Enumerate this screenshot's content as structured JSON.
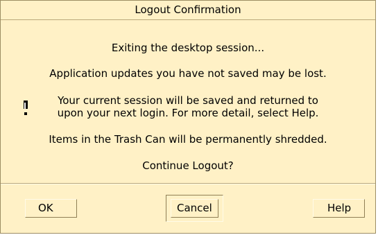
{
  "dialog": {
    "title": "Logout Confirmation",
    "messages": [
      "Exiting the desktop session...",
      "Application updates you have not saved may be lost.",
      "Your current session will be saved and returned to",
      "upon your next login.  For more detail, select Help.",
      "Items in the Trash Can will be permanently shredded.",
      "Continue Logout?"
    ],
    "icon": "exclamation-icon"
  },
  "buttons": {
    "ok": "OK",
    "cancel": "Cancel",
    "help": "Help"
  },
  "colors": {
    "background": "#fff1c6",
    "border": "#9c8d63"
  }
}
